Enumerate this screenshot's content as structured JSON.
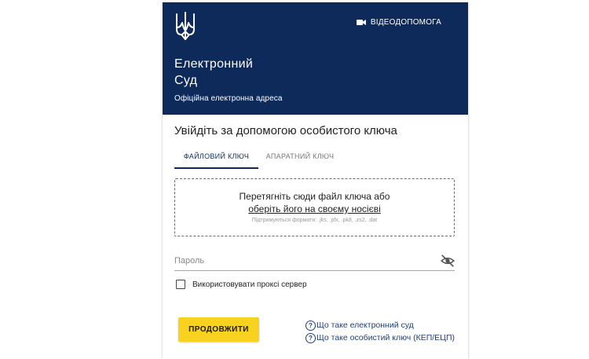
{
  "header": {
    "logo_icon": "trident-icon",
    "video_help_icon": "video-camera-icon",
    "video_help_label": "ВІДЕОДОПОМОГА",
    "app_title_line1": "Електронний",
    "app_title_line2": "Суд",
    "subtitle": "Офіційна електронна адреса",
    "background_color": "#0e2a5b"
  },
  "login": {
    "title": "Увійдіть за допомогою особистого ключа",
    "tabs": [
      {
        "label": "ФАЙЛОВИЙ КЛЮЧ",
        "active": true
      },
      {
        "label": "АПАРАТНИЙ КЛЮЧ",
        "active": false
      }
    ],
    "dropzone": {
      "line1": "Перетягніть сюди файл ключа або",
      "line2": "оберіть його на своєму носієві",
      "formats": "Підтримуються формати: .jks, .pfx, .pk8, .zs2, .dat"
    },
    "password": {
      "placeholder": "Пароль",
      "value": "",
      "toggle_icon": "eye-off-icon"
    },
    "proxy": {
      "label": "Використовувати проксі сервер",
      "checked": false
    },
    "continue_label": "ПРОДОВЖИТИ",
    "continue_color": "#f7d21e",
    "help_links": [
      {
        "icon": "help-circle-icon",
        "label": "Що таке електронний суд"
      },
      {
        "icon": "help-circle-icon",
        "label": "Що таке особистий ключ (КЕП/ЕЦП)"
      }
    ]
  }
}
